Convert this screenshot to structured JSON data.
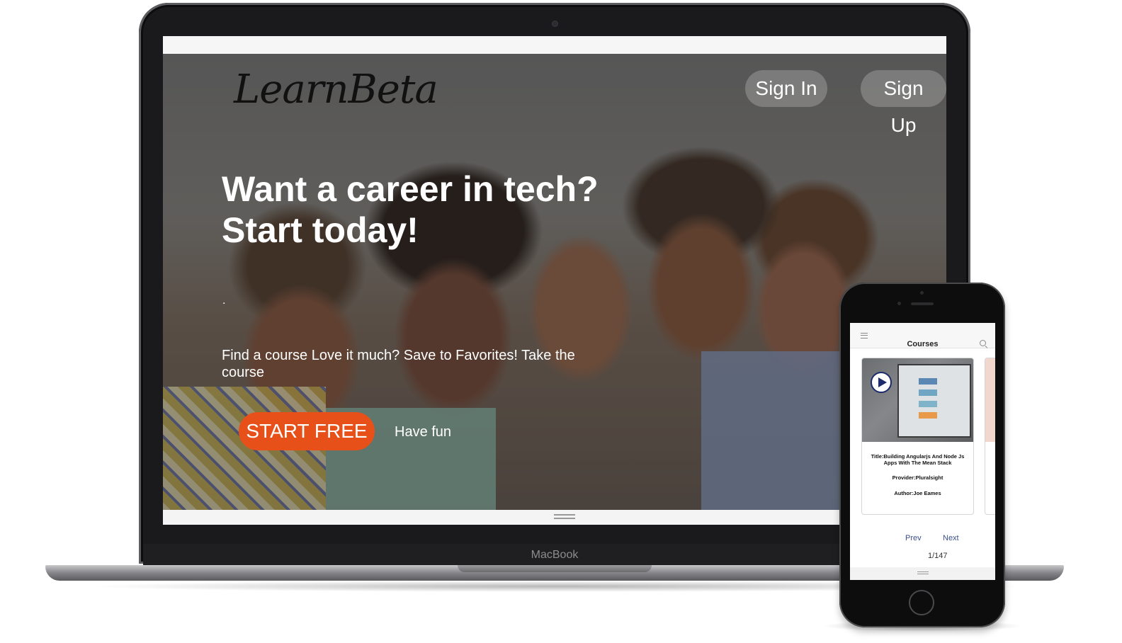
{
  "laptop": {
    "brand_label": "MacBook",
    "site": {
      "logo": "LearnBeta",
      "nav": {
        "sign_in": "Sign In",
        "sign_up": "Sign Up"
      },
      "hero": {
        "headline_line1": "Want a career in tech?",
        "headline_line2": "Start today!",
        "dot": ".",
        "subtext": "Find a course Love it much? Save to Favorites! Take the course",
        "cta_label": "START FREE",
        "secondary_label": "Have fun"
      }
    }
  },
  "phone": {
    "app": {
      "title": "Courses",
      "card": {
        "title": "Title:Building Angularjs And Node Js Apps With The Mean Stack",
        "provider": "Provider:Pluralsight",
        "author": "Author:Joe Eames"
      },
      "pager": {
        "prev": "Prev",
        "next": "Next",
        "count": "1/147"
      }
    }
  },
  "colors": {
    "cta": "#e8501a",
    "pager_link": "#3b4f8a",
    "play_icon": "#1d2a6b"
  },
  "icons": [
    "menu-icon",
    "search-icon",
    "play-icon",
    "drag-handle-icon"
  ]
}
